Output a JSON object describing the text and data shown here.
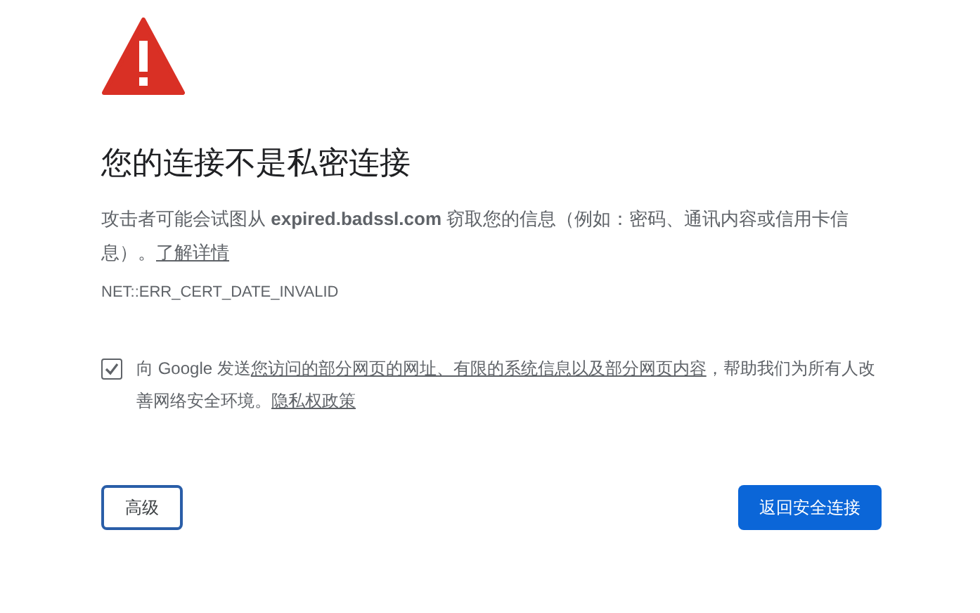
{
  "heading": "您的连接不是私密连接",
  "description": {
    "text": "攻击者可能会试图从 **expired.badssl.com** 窃取您的信息（例如：密码、通讯内容或信用卡信息）。",
    "link": "了解详情"
  },
  "error_code": "NET::ERR_CERT_DATE_INVALID",
  "report_option": {
    "checked": true,
    "parts": [
      {
        "kind": "text",
        "text": "向 Google 发送"
      },
      {
        "kind": "link",
        "text": "您访问的部分网页的网址、有限的系统信息以及部分网页内容"
      },
      {
        "kind": "text",
        "text": "，帮助我们为所有人改善网络安全环境。"
      },
      {
        "kind": "link",
        "text": "隐私权政策"
      }
    ]
  },
  "buttons": [
    {
      "label": "高级",
      "kind": "secondary"
    },
    {
      "label": "返回安全连接",
      "kind": "primary"
    }
  ]
}
